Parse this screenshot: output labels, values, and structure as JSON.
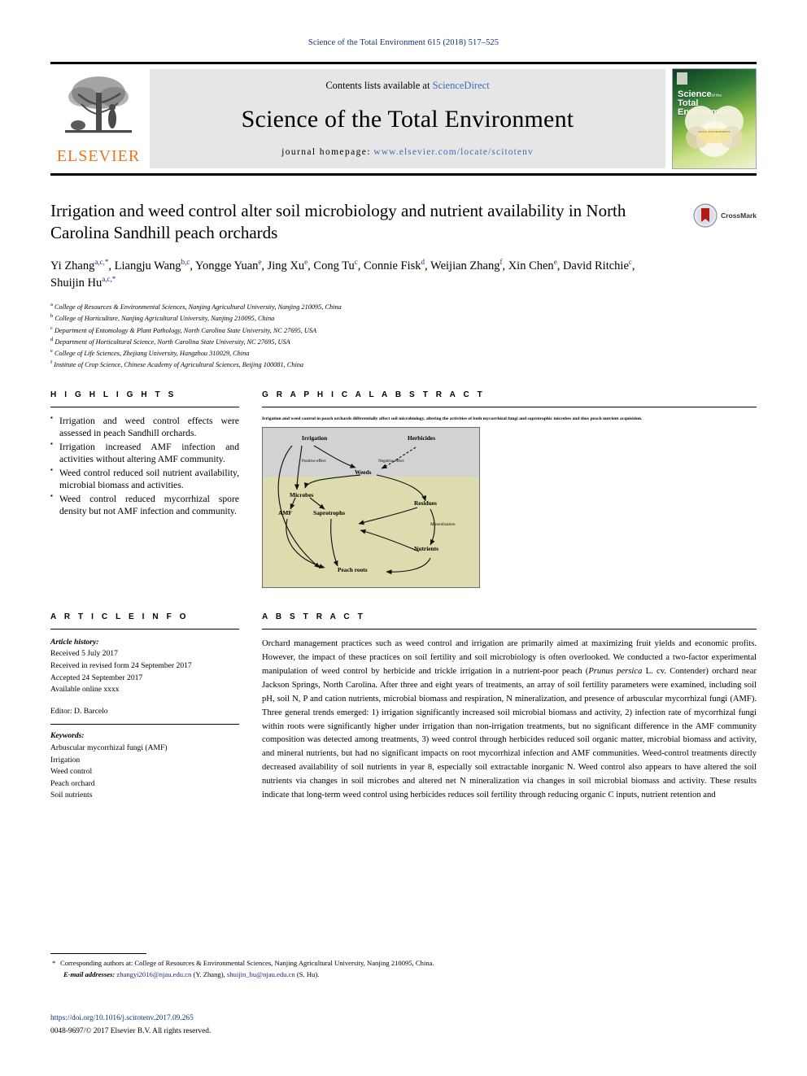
{
  "running_head": "Science of the Total Environment 615 (2018) 517–525",
  "masthead": {
    "publisher_name": "ELSEVIER",
    "contents_prefix": "Contents lists available at",
    "contents_link": "ScienceDirect",
    "journal_title": "Science of the Total Environment",
    "homepage_label": "journal homepage:",
    "homepage_url": "www.elsevier.com/locate/scitotenv",
    "cover": {
      "title_line1": "Science",
      "title_of": "of the",
      "title_line2": "Total Environment",
      "blob_caption": "TOTAL ENVIRONMENT"
    }
  },
  "article": {
    "title": "Irrigation and weed control alter soil microbiology and nutrient availability in North Carolina Sandhill peach orchards",
    "crossmark_label": "CrossMark",
    "authors": [
      {
        "name": "Yi Zhang",
        "sup": "a,c,*",
        "sep": ", "
      },
      {
        "name": "Liangju Wang",
        "sup": "b,c",
        "sep": ", "
      },
      {
        "name": "Yongge Yuan",
        "sup": "e",
        "sep": ", "
      },
      {
        "name": "Jing Xu",
        "sup": "e",
        "sep": ", "
      },
      {
        "name": "Cong Tu",
        "sup": "c",
        "sep": ", "
      },
      {
        "name": "Connie Fisk",
        "sup": "d",
        "sep": ", "
      },
      {
        "name": "Weijian Zhang",
        "sup": "f",
        "sep": ", "
      },
      {
        "name": "Xin Chen",
        "sup": "e",
        "sep": ", "
      },
      {
        "name": "David Ritchie",
        "sup": "c",
        "sep": ", "
      },
      {
        "name": "Shuijin Hu",
        "sup": "a,c,*",
        "sep": ""
      }
    ],
    "affiliations": [
      {
        "sup": "a",
        "text": "College of Resources & Environmental Sciences, Nanjing Agricultural University, Nanjing 210095, China"
      },
      {
        "sup": "b",
        "text": "College of Horticulture, Nanjing Agricultural University, Nanjing 210095, China"
      },
      {
        "sup": "c",
        "text": "Department of Entomology & Plant Pathology, North Carolina State University, NC 27695, USA"
      },
      {
        "sup": "d",
        "text": "Department of Horticultural Science, North Carolina State University, NC 27695, USA"
      },
      {
        "sup": "e",
        "text": "College of Life Sciences, Zhejiang University, Hangzhou 310029, China"
      },
      {
        "sup": "f",
        "text": "Institute of Crop Science, Chinese Academy of Agricultural Sciences, Beijing 100081, China"
      }
    ]
  },
  "highlights": {
    "heading": "H I G H L I G H T S",
    "items": [
      "Irrigation and weed control effects were assessed in peach Sandhill orchards.",
      "Irrigation increased AMF infection and activities without altering AMF community.",
      "Weed control reduced soil nutrient availability, microbial biomass and activities.",
      "Weed control reduced mycorrhizal spore density but not AMF infection and community."
    ]
  },
  "graphical_abstract": {
    "heading": "G R A P H I C A L  A B S T R A C T",
    "caption": "Irrigation and weed control in peach orchards differentially affect soil microbiology, altering the activities of both mycorrhizal fungi and saprotrophic microbes and thus peach nutrient acquisition.",
    "nodes": {
      "irrigation": "Irrigation",
      "herbicides": "Herbicides",
      "weeds": "Weeds",
      "microbes": "Microbes",
      "amf": "AMF",
      "saprotrophs": "Saprotrophs",
      "residues": "Residues",
      "nutrients": "Nutrients",
      "peach_roots": "Peach roots"
    },
    "edge_labels": {
      "positive": "Positive effect",
      "negative": "Negative effect",
      "mineralization": "Mineralization"
    },
    "colors": {
      "sky": "#d2d2d2",
      "soil": "#dcdcae",
      "border": "#6b6b6b"
    }
  },
  "article_info": {
    "heading": "A R T I C L E  I N F O",
    "history_label": "Article history:",
    "history": [
      "Received 5 July 2017",
      "Received in revised form 24 September 2017",
      "Accepted 24 September 2017",
      "Available online xxxx"
    ],
    "editor": "Editor: D. Barcelo",
    "keywords_label": "Keywords:",
    "keywords": [
      "Arbuscular mycorrhizal fungi (AMF)",
      "Irrigation",
      "Weed control",
      "Peach orchard",
      "Soil nutrients"
    ]
  },
  "abstract": {
    "heading": "A B S T R A C T",
    "part1": "Orchard management practices such as weed control and irrigation are primarily aimed at maximizing fruit yields and economic profits. However, the impact of these practices on soil fertility and soil microbiology is often overlooked. We conducted a two-factor experimental manipulation of weed control by herbicide and trickle irrigation in a nutrient-poor peach (",
    "species": "Prunus persica",
    "part2": " L. cv. Contender) orchard near Jackson Springs, North Carolina. After three and eight years of treatments, an array of soil fertility parameters were examined, including soil pH, soil N, P and cation nutrients, microbial biomass and respiration, N mineralization, and presence of arbuscular mycorrhizal fungi (AMF). Three general trends emerged: 1) irrigation significantly increased soil microbial biomass and activity, 2) infection rate of mycorrhizal fungi within roots were significantly higher under irrigation than non-irrigation treatments, but no significant difference in the AMF community composition was detected among treatments, 3) weed control through herbicides reduced soil organic matter, microbial biomass and activity, and mineral nutrients, but had no significant impacts on root mycorrhizal infection and AMF communities. Weed-control treatments directly decreased availability of soil nutrients in year 8, especially soil extractable inorganic N. Weed control also appears to have altered the soil nutrients via changes in soil microbes and altered net N mineralization via changes in soil microbial biomass and activity. These results indicate that long-term weed control using herbicides reduces soil fertility through reducing organic C inputs, nutrient retention and"
  },
  "footnotes": {
    "corresponding_marker": "*",
    "corresponding_text": "Corresponding authors at: College of Resources & Environmental Sciences, Nanjing Agricultural University, Nanjing 210095, China.",
    "email_label": "E-mail addresses:",
    "email1": "zhangyi2016@njau.edu.cn",
    "email1_owner": "(Y. Zhang),",
    "email2": "shuijin_hu@njau.edu.cn",
    "email2_owner": "(S. Hu).",
    "doi": "https://doi.org/10.1016/j.scitotenv.2017.09.265",
    "copyright": "0048-9697/© 2017 Elsevier B.V. All rights reserved."
  }
}
